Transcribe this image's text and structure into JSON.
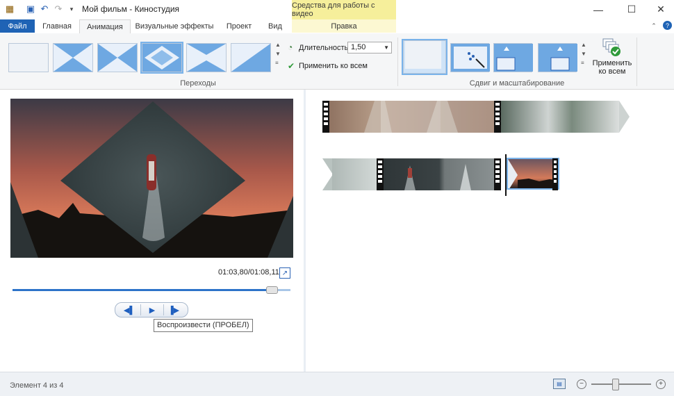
{
  "app": {
    "title": "Мой фильм - Киностудия",
    "context_tab_header": "Средства для работы с видео"
  },
  "tabs": [
    {
      "label": "Файл"
    },
    {
      "label": "Главная"
    },
    {
      "label": "Анимация"
    },
    {
      "label": "Визуальные эффекты"
    },
    {
      "label": "Проект"
    },
    {
      "label": "Вид"
    },
    {
      "label": "Правка"
    }
  ],
  "ribbon": {
    "transitions_group_label": "Переходы",
    "pan_zoom_group_label": "Сдвиг и масштабирование",
    "duration_label": "Длительность:",
    "duration_value": "1,50",
    "apply_all_small": "Применить ко всем",
    "apply_all_big": "Применить ко всем"
  },
  "preview": {
    "timecode": "01:03,80/01:08,11",
    "seek_progress": 0.93,
    "tooltip": "Воспроизвести (ПРОБЕЛ)"
  },
  "status": {
    "text": "Элемент 4 из 4",
    "zoom_level": 0.4
  },
  "colors": {
    "accent": "#1f63b5",
    "context_tab": "#f6ef9b",
    "selection": "#7ab3ea"
  }
}
